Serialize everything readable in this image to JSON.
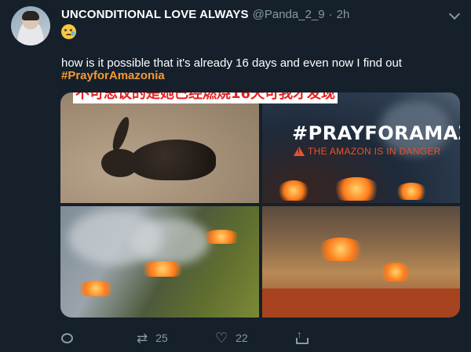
{
  "tweet": {
    "display_name": "UNCONDITIONAL LOVE ALWAYS",
    "handle": "@Panda_2_9",
    "separator": "·",
    "time": "2h",
    "emoji": "crying-face",
    "text": "how is it possible that it's already 16 days and even now I find out",
    "hashtag": "#PrayforAmazonia"
  },
  "media": {
    "caption_overlay": "不可思议的是她已经燃烧16天可我才发现",
    "poster_title": "#PRAYFORAMAZONIA",
    "poster_subtitle": "THE AMAZON IS IN DANGER"
  },
  "actions": {
    "reply_icon": "reply-icon",
    "retweet_count": "25",
    "like_count": "22",
    "share_icon": "share-icon"
  },
  "colors": {
    "background": "#15202b",
    "hashtag": "#f59a35",
    "muted": "#8899a6",
    "caption_text": "#e81e1e",
    "danger": "#e8542c"
  }
}
